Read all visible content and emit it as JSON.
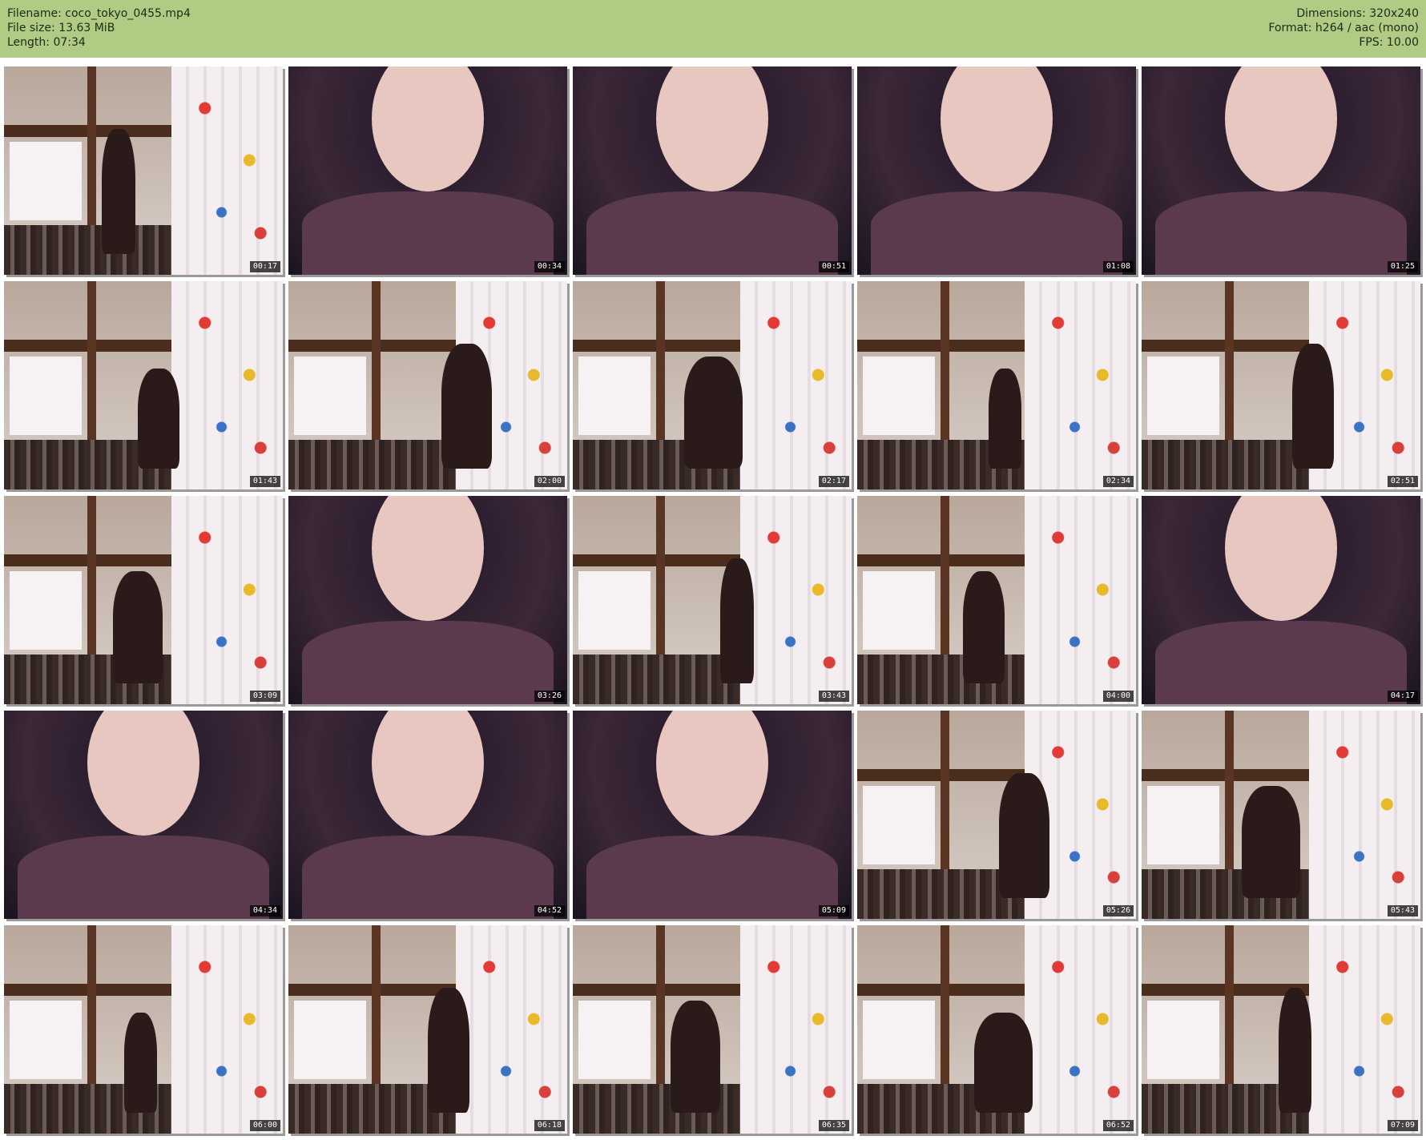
{
  "header": {
    "filename": "Filename: coco_tokyo_0455.mp4",
    "filesize": "File size: 13.63 MiB",
    "length": "Length: 07:34",
    "dimensions": "Dimensions: 320x240",
    "format": "Format: h264 / aac (mono)",
    "fps": "FPS: 10.00"
  },
  "colors": {
    "header_bg": "#b0cb84",
    "header_text": "#1e2a14",
    "timestamp_bg": "#000000",
    "timestamp_text": "#ffffff"
  },
  "thumbnails": [
    {
      "time": "00:17",
      "scene": "room"
    },
    {
      "time": "00:34",
      "scene": "close"
    },
    {
      "time": "00:51",
      "scene": "close"
    },
    {
      "time": "01:08",
      "scene": "close"
    },
    {
      "time": "01:25",
      "scene": "close"
    },
    {
      "time": "01:43",
      "scene": "room"
    },
    {
      "time": "02:00",
      "scene": "room"
    },
    {
      "time": "02:17",
      "scene": "room"
    },
    {
      "time": "02:34",
      "scene": "room"
    },
    {
      "time": "02:51",
      "scene": "room"
    },
    {
      "time": "03:09",
      "scene": "room"
    },
    {
      "time": "03:26",
      "scene": "close"
    },
    {
      "time": "03:43",
      "scene": "room"
    },
    {
      "time": "04:00",
      "scene": "room"
    },
    {
      "time": "04:17",
      "scene": "close"
    },
    {
      "time": "04:34",
      "scene": "close"
    },
    {
      "time": "04:52",
      "scene": "close"
    },
    {
      "time": "05:09",
      "scene": "close"
    },
    {
      "time": "05:26",
      "scene": "room"
    },
    {
      "time": "05:43",
      "scene": "room"
    },
    {
      "time": "06:00",
      "scene": "room"
    },
    {
      "time": "06:18",
      "scene": "room"
    },
    {
      "time": "06:35",
      "scene": "room"
    },
    {
      "time": "06:52",
      "scene": "room"
    },
    {
      "time": "07:09",
      "scene": "room"
    }
  ]
}
